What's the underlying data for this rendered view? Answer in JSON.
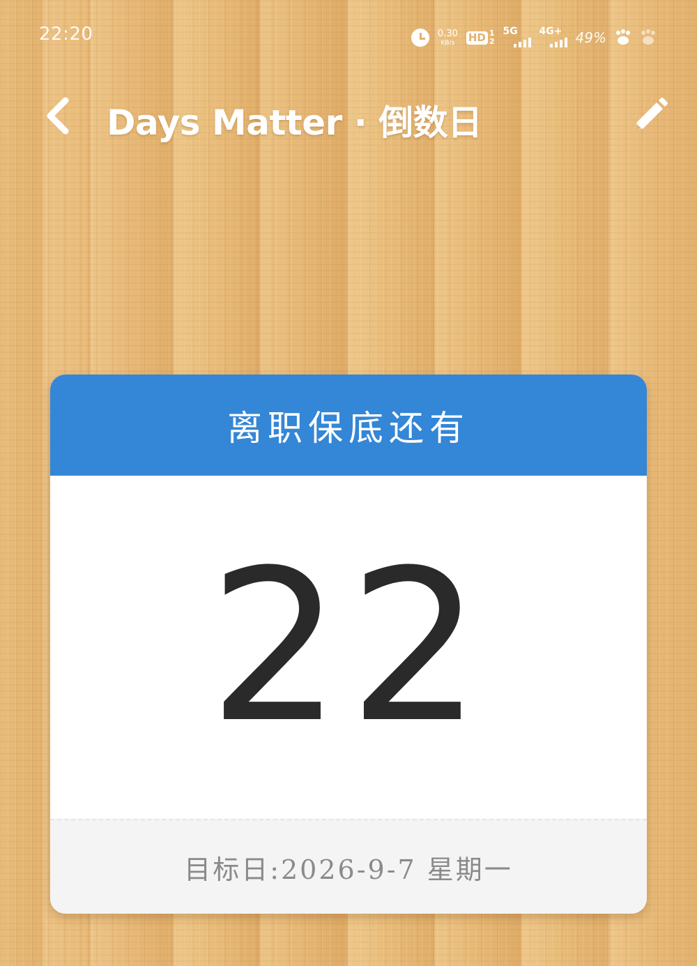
{
  "status_bar": {
    "time": "22:20",
    "net_speed_value": "0.30",
    "net_speed_unit": "KB/s",
    "hd_label": "HD",
    "hd_top": "1",
    "hd_bottom": "2",
    "signal_1_label": "5G",
    "signal_2_label": "4G+",
    "battery": "49%",
    "icons": [
      "alarm-icon",
      "hd-icon",
      "signal-5g-icon",
      "signal-4g-icon",
      "paw-icon",
      "paw-icon"
    ]
  },
  "header": {
    "title": "Days Matter · 倒数日",
    "back_icon": "chevron-left-icon",
    "edit_icon": "pencil-icon"
  },
  "card": {
    "label": "离职保底还有",
    "days": "22",
    "target_date": "目标日:2026-9-7 星期一",
    "colors": {
      "header": "#3486d6",
      "body": "#ffffff",
      "footer": "#f4f4f4"
    }
  }
}
